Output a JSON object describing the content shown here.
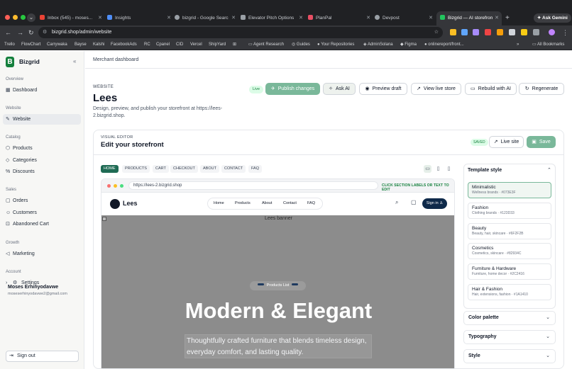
{
  "browser": {
    "tabs": [
      {
        "title": "Inbox (545) - moses...",
        "color": "#ea4335"
      },
      {
        "title": "Insights",
        "color": "#4f8ef7"
      },
      {
        "title": "bizgrid - Google Searc",
        "color": "#9aa0a6"
      },
      {
        "title": "Elevator Pitch Options",
        "color": "#9aa0a6"
      },
      {
        "title": "PlanPal",
        "color": "#e94f64"
      },
      {
        "title": "Devpost",
        "color": "#9aa0a6"
      },
      {
        "title": "Bizgrid — AI storefron",
        "color": "#22c55e"
      }
    ],
    "new_tab": "+",
    "gemini": "Ask Gemini",
    "url": "bizgrid.shop/admin/website",
    "bookmarks": [
      "Trello",
      "FlowChart",
      "Carrywaka",
      "Bayse",
      "Kalshi",
      "FacebookAds",
      "RC",
      "Cpanel",
      "CID",
      "Vercel",
      "ShipYard",
      "Agent Research",
      "Guides",
      "Your Repositories",
      "AdminSolana",
      "Figma",
      "onlinereport/front...",
      "All Bookmarks"
    ]
  },
  "sidebar": {
    "brand": "Bizgrid",
    "logo_letter": "B",
    "sections": [
      {
        "label": "Overview",
        "items": [
          {
            "label": "Dashboard",
            "icon": "dashboard-icon"
          }
        ]
      },
      {
        "label": "Website",
        "items": [
          {
            "label": "Website",
            "icon": "website-icon",
            "active": true
          }
        ]
      },
      {
        "label": "Catalog",
        "items": [
          {
            "label": "Products",
            "icon": "products-icon"
          },
          {
            "label": "Categories",
            "icon": "categories-icon"
          },
          {
            "label": "Discounts",
            "icon": "discounts-icon"
          }
        ]
      },
      {
        "label": "Sales",
        "items": [
          {
            "label": "Orders",
            "icon": "orders-icon"
          },
          {
            "label": "Customers",
            "icon": "customers-icon"
          },
          {
            "label": "Abandoned Cart",
            "icon": "cart-icon"
          }
        ]
      },
      {
        "label": "Growth",
        "items": [
          {
            "label": "Marketing",
            "icon": "marketing-icon"
          }
        ]
      },
      {
        "label": "Account",
        "items": [
          {
            "label": "Settings",
            "icon": "gear-icon"
          }
        ]
      }
    ],
    "user_name": "Moses Erhinyodavwe",
    "user_email": "moseserhinyodavwe2@gmail.com",
    "sign_out": "Sign out"
  },
  "header": {
    "breadcrumb": "Merchant dashboard"
  },
  "page": {
    "eyebrow": "WEBSITE",
    "title": "Lees",
    "description": "Design, preview, and publish your storefront at https://lees-2.bizgrid.shop.",
    "status": "Live",
    "actions": [
      "Publish changes",
      "Ask AI",
      "Preview draft",
      "View live store",
      "Rebuild with AI",
      "Regenerate"
    ]
  },
  "editor": {
    "eyebrow": "VISUAL EDITOR",
    "title": "Edit your storefront",
    "saved": "SAVED",
    "live_site": "Live site",
    "save": "Save",
    "page_tabs": [
      "HOME",
      "PRODUCTS",
      "CART",
      "CHECKOUT",
      "ABOUT",
      "CONTACT",
      "FAQ"
    ],
    "active_tab": "HOME"
  },
  "preview": {
    "url": "https://lees-2.bizgrid.shop",
    "hint": "CLICK SECTION LABELS OR TEXT TO EDIT",
    "store_name": "Lees",
    "menu": [
      "Home",
      "Products",
      "About",
      "Contact",
      "FAQ"
    ],
    "sign_in": "Sign in",
    "banner_alt": "Lees banner",
    "badge": "Products List",
    "headline": "Modern & Elegant",
    "subtext": "Thoughtfully crafted furniture that blends timeless design, everyday comfort, and lasting quality."
  },
  "template_style": {
    "title": "Template style",
    "options": [
      {
        "name": "Minimalistic",
        "desc": "Wellness brands · #073E3F",
        "selected": true
      },
      {
        "name": "Fashion",
        "desc": "Clothing brands · #123D33"
      },
      {
        "name": "Beauty",
        "desc": "Beauty, hair, skincare · #6F2F2B"
      },
      {
        "name": "Cosmetics",
        "desc": "Cosmetics, skincare · #82934C"
      },
      {
        "name": "Furniture & Hardware",
        "desc": "Furniture, home decor · #2C2416"
      },
      {
        "name": "Hair & Fashion",
        "desc": "Hair, extensions, fashion · #1A1410"
      }
    ]
  },
  "panels": [
    "Color palette",
    "Typography",
    "Style"
  ],
  "colors": {
    "accent": "#15803d",
    "publish": "#7ab89a",
    "sign_in": "#0f2a4a"
  }
}
